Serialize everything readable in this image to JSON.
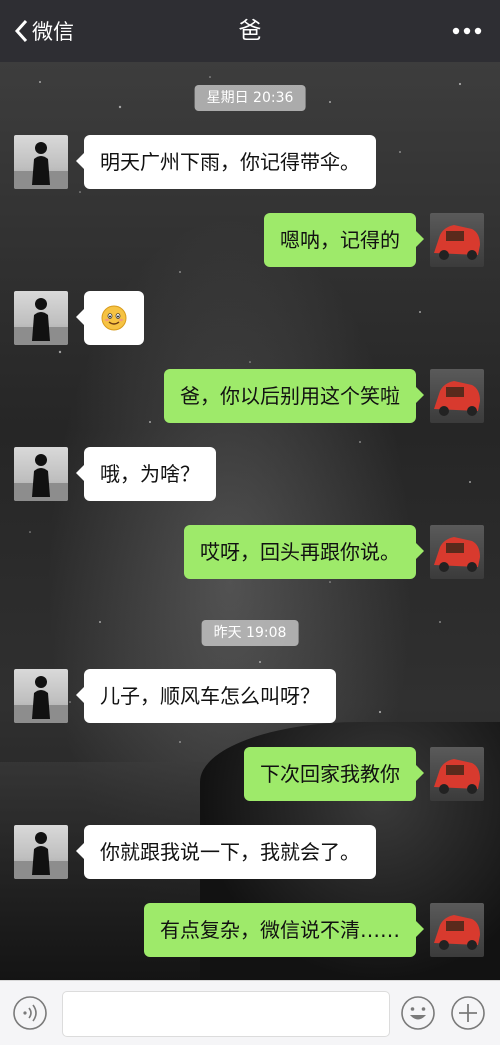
{
  "header": {
    "back_label": "微信",
    "title": "爸"
  },
  "timestamps": [
    "星期日 20:36",
    "昨天 19:08"
  ],
  "messages": [
    {
      "side": "left",
      "text": "明天广州下雨，你记得带伞。"
    },
    {
      "side": "right",
      "text": "嗯呐，记得的"
    },
    {
      "side": "left",
      "text": "",
      "emoji": "smile-emoji"
    },
    {
      "side": "right",
      "text": "爸，你以后别用这个笑啦"
    },
    {
      "side": "left",
      "text": "哦，为啥？"
    },
    {
      "side": "right",
      "text": "哎呀，回头再跟你说。"
    },
    {
      "side": "left",
      "text": "儿子，顺风车怎么叫呀？"
    },
    {
      "side": "right",
      "text": "下次回家我教你"
    },
    {
      "side": "left",
      "text": "你就跟我说一下，我就会了。"
    },
    {
      "side": "right",
      "text": "有点复杂，微信说不清……"
    }
  ],
  "icons": {
    "back": "chevron-left-icon",
    "more": "more-dots-icon",
    "voice": "voice-icon",
    "emoji": "emoji-icon",
    "plus": "plus-icon"
  },
  "colors": {
    "topbar": "#2e2e33",
    "sent_bubble": "#9eea6a",
    "received_bubble": "#ffffff"
  }
}
